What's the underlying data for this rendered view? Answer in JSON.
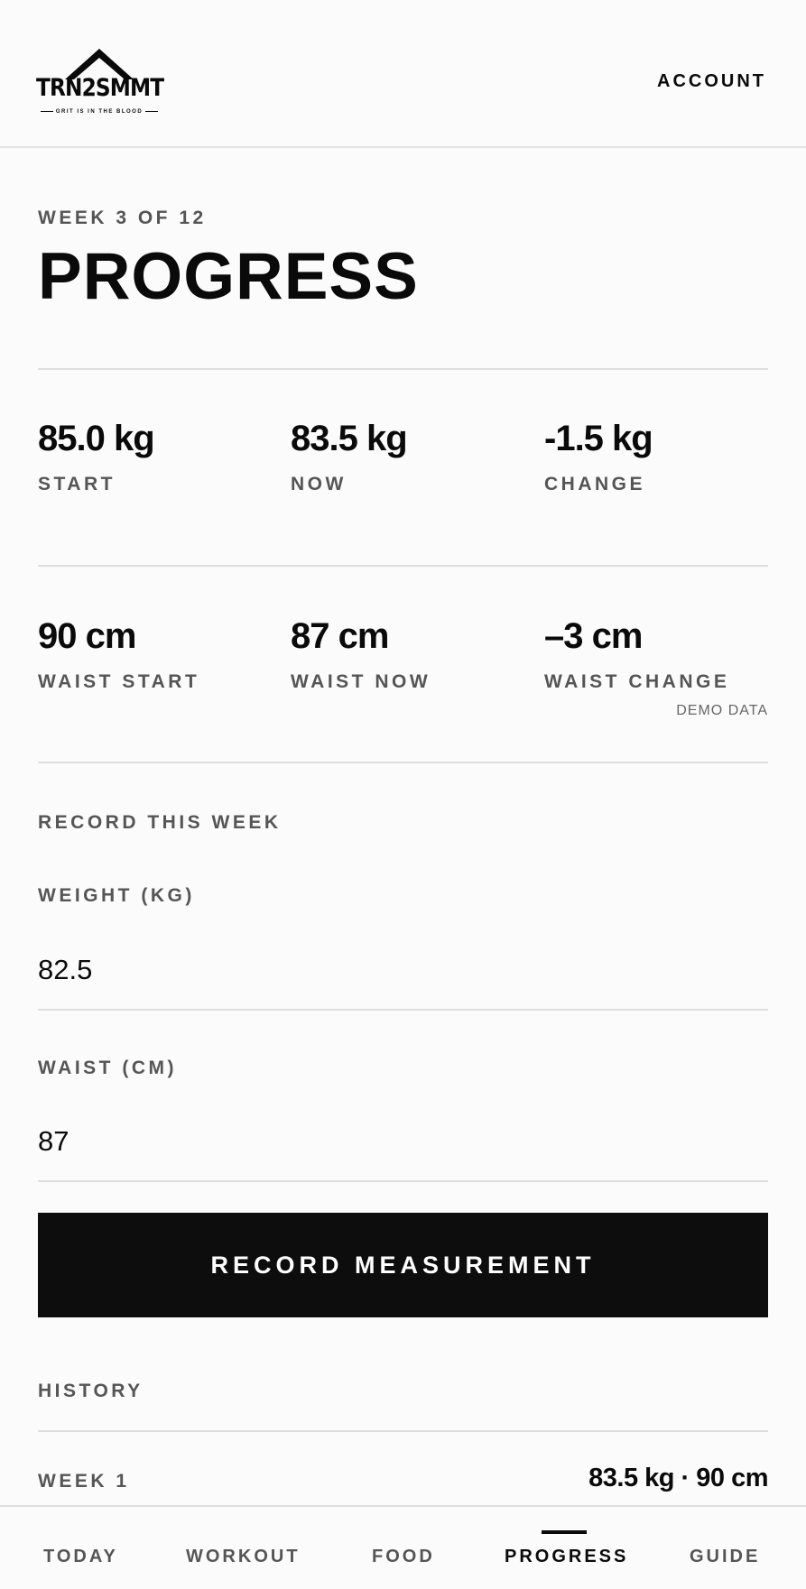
{
  "header": {
    "logo_text": "TRN2SMMT",
    "logo_tagline": "GRIT IS IN THE BLOOD",
    "account_label": "ACCOUNT"
  },
  "page": {
    "week_label": "WEEK 3 OF 12",
    "title": "PROGRESS"
  },
  "weight_stats": [
    {
      "value": "85.0 kg",
      "label": "START"
    },
    {
      "value": "83.5 kg",
      "label": "NOW"
    },
    {
      "value": "-1.5 kg",
      "label": "CHANGE"
    }
  ],
  "waist_stats": [
    {
      "value": "90 cm",
      "label": "WAIST START"
    },
    {
      "value": "87 cm",
      "label": "WAIST NOW"
    },
    {
      "value": "–3 cm",
      "label": "WAIST CHANGE"
    }
  ],
  "demo_note": "DEMO DATA",
  "record": {
    "section_label": "RECORD THIS WEEK",
    "weight_label": "WEIGHT (KG)",
    "weight_value": "82.5",
    "waist_label": "WAIST (CM)",
    "waist_value": "87",
    "button_label": "RECORD MEASUREMENT"
  },
  "history": {
    "section_label": "HISTORY",
    "rows": [
      {
        "week": "WEEK 1",
        "value": "83.5 kg · 90 cm"
      }
    ]
  },
  "tabs": [
    {
      "label": "TODAY",
      "active": false
    },
    {
      "label": "WORKOUT",
      "active": false
    },
    {
      "label": "FOOD",
      "active": false
    },
    {
      "label": "PROGRESS",
      "active": true
    },
    {
      "label": "GUIDE",
      "active": false
    }
  ]
}
